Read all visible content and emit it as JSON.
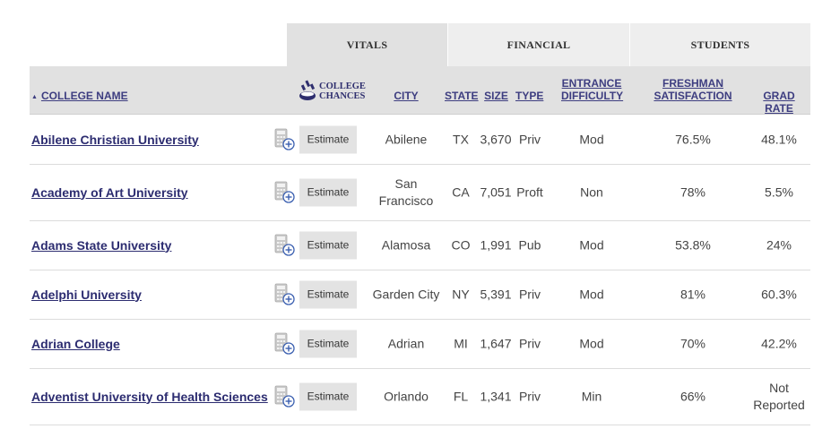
{
  "groups": {
    "vitals": "VITALS",
    "financial": "FINANCIAL",
    "students": "STUDENTS"
  },
  "columns": {
    "college_name": "COLLEGE NAME",
    "college_chances_line1": "COLLEGE",
    "college_chances_line2": "CHANCES",
    "city": "CITY",
    "state": "STATE",
    "size": "SIZE",
    "type": "TYPE",
    "entrance_line1": "ENTRANCE",
    "entrance_line2": "DIFFICULTY",
    "freshman_line1": "FRESHMAN",
    "freshman_line2": "SATISFACTION",
    "grad_rate": "GRAD RATE"
  },
  "estimate_label": "Estimate",
  "rows": [
    {
      "name": "Abilene Christian University",
      "city": "Abilene",
      "city2": "",
      "state": "TX",
      "size": "3,670",
      "type": "Priv",
      "difficulty": "Mod",
      "satisfaction": "76.5%",
      "grad": "48.1%",
      "grad2": ""
    },
    {
      "name": "Academy of Art University",
      "city": "San",
      "city2": "Francisco",
      "state": "CA",
      "size": "7,051",
      "type": "Proft",
      "difficulty": "Non",
      "satisfaction": "78%",
      "grad": "5.5%",
      "grad2": ""
    },
    {
      "name": "Adams State University",
      "city": "Alamosa",
      "city2": "",
      "state": "CO",
      "size": "1,991",
      "type": "Pub",
      "difficulty": "Mod",
      "satisfaction": "53.8%",
      "grad": "24%",
      "grad2": ""
    },
    {
      "name": "Adelphi University",
      "city": "Garden City",
      "city2": "",
      "state": "NY",
      "size": "5,391",
      "type": "Priv",
      "difficulty": "Mod",
      "satisfaction": "81%",
      "grad": "60.3%",
      "grad2": ""
    },
    {
      "name": "Adrian College",
      "city": "Adrian",
      "city2": "",
      "state": "MI",
      "size": "1,647",
      "type": "Priv",
      "difficulty": "Mod",
      "satisfaction": "70%",
      "grad": "42.2%",
      "grad2": ""
    },
    {
      "name": "Adventist University of Health Sciences",
      "city": "Orlando",
      "city2": "",
      "state": "FL",
      "size": "1,341",
      "type": "Priv",
      "difficulty": "Min",
      "satisfaction": "66%",
      "grad": "Not",
      "grad2": "Reported"
    }
  ]
}
